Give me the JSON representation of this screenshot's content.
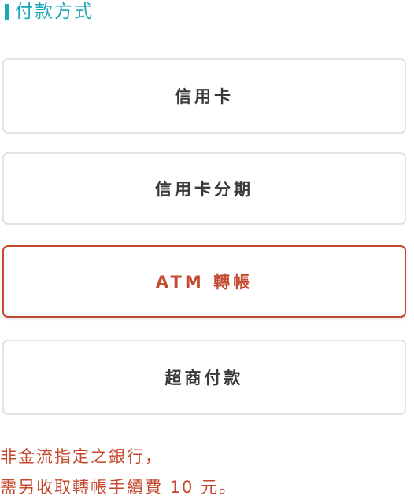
{
  "section": {
    "title": "付款方式"
  },
  "payment_options": [
    {
      "label": "信用卡",
      "selected": false
    },
    {
      "label": "信用卡分期",
      "selected": false
    },
    {
      "label": "ATM 轉帳",
      "selected": true
    },
    {
      "label": "超商付款",
      "selected": false
    }
  ],
  "note": {
    "line1": "非金流指定之銀行，",
    "line2": "需另收取轉帳手續費 10 元。"
  },
  "colors": {
    "accent": "#1aa8b8",
    "selected": "#c5492f",
    "border": "#e2e2e2",
    "text": "#3a3a3a"
  }
}
